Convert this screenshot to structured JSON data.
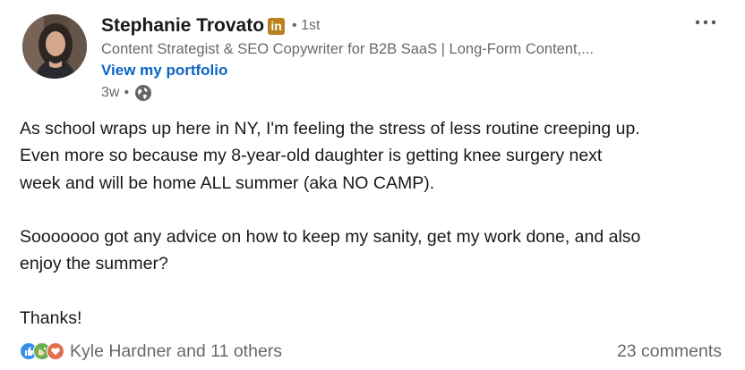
{
  "author": {
    "name": "Stephanie Trovato",
    "badge_text": "in",
    "degree": "• 1st",
    "headline": "Content Strategist & SEO Copywriter for B2B SaaS | Long-Form Content,...",
    "portfolio_link": "View my portfolio",
    "time_ago": "3w",
    "separator": "•",
    "visibility_icon": "globe-icon",
    "avatar_icon": "profile-photo"
  },
  "menu_icon": "more-options-icon",
  "post": {
    "paragraphs": [
      [
        "As school wraps up here in NY, I'm feeling the stress of less routine creeping up.",
        "Even more so because my 8-year-old daughter is getting knee surgery next",
        "week and will be home ALL summer (aka NO CAMP)."
      ],
      [
        "Sooooooo got any advice on how to keep my sanity, get my work done, and also",
        "enjoy the summer?"
      ],
      [
        "Thanks!"
      ]
    ]
  },
  "social": {
    "reaction_icons": [
      "like-icon",
      "celebrate-icon",
      "love-icon"
    ],
    "reactions_text": "Kyle Hardner and 11 others",
    "comments_text": "23 comments"
  },
  "colors": {
    "link_blue": "#0a66c2",
    "badge_gold": "#b9811d",
    "like_blue": "#378fe9",
    "celebrate_green": "#6dae4f",
    "love_red": "#df704d"
  }
}
